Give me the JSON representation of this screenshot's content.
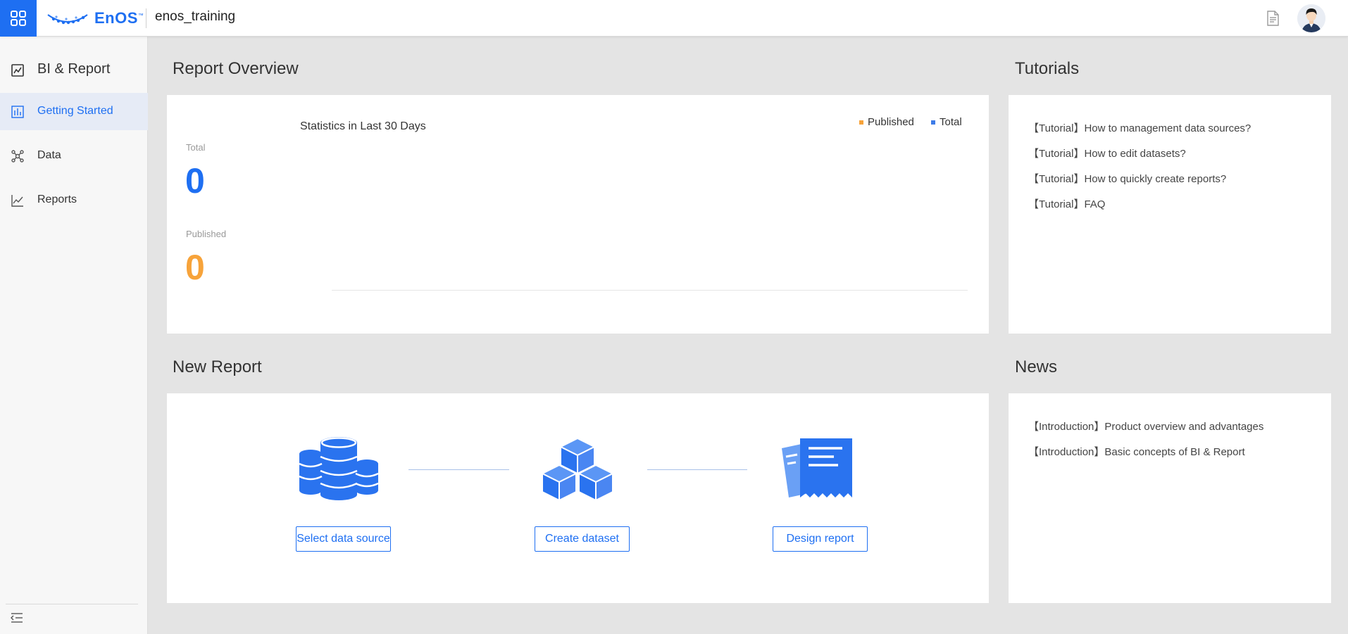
{
  "header": {
    "logo_text": "EnOS",
    "logo_tm": "™",
    "org_name": "enos_training",
    "icons": {
      "app_switcher": "grid-icon",
      "docs": "document-icon",
      "avatar": "user-avatar"
    }
  },
  "sidebar": {
    "title": "BI & Report",
    "items": [
      {
        "label": "Getting Started",
        "icon": "bar-chart-icon",
        "active": true
      },
      {
        "label": "Data",
        "icon": "molecule-icon",
        "active": false
      },
      {
        "label": "Reports",
        "icon": "line-chart-icon",
        "active": false
      }
    ],
    "collapse_icon": "collapse-menu-icon"
  },
  "overview": {
    "section_title": "Report Overview",
    "total_label": "Total",
    "total_value": "0",
    "published_label": "Published",
    "published_value": "0",
    "chart_title": "Statistics in Last 30 Days",
    "legend": [
      {
        "label": "Published",
        "color": "#f7a33a"
      },
      {
        "label": "Total",
        "color": "#3e7ce8"
      }
    ]
  },
  "chart_data": {
    "type": "line",
    "title": "Statistics in Last 30 Days",
    "series": [
      {
        "name": "Published",
        "values": []
      },
      {
        "name": "Total",
        "values": []
      }
    ],
    "legend_position": "top-right"
  },
  "tutorials": {
    "section_title": "Tutorials",
    "items": [
      "【Tutorial】How to management data sources?",
      "【Tutorial】How to edit datasets?",
      "【Tutorial】How to quickly create reports?",
      "【Tutorial】FAQ"
    ]
  },
  "new_report": {
    "section_title": "New Report",
    "steps": [
      {
        "button": "Select data source",
        "icon": "database-icon"
      },
      {
        "button": "Create dataset",
        "icon": "cubes-icon"
      },
      {
        "button": "Design report",
        "icon": "report-document-icon"
      }
    ]
  },
  "news": {
    "section_title": "News",
    "items": [
      "【Introduction】Product overview and advantages",
      "【Introduction】Basic concepts of BI & Report"
    ]
  },
  "colors": {
    "accent": "#1e6ff2",
    "total_value": "#1e6ff2",
    "published_value": "#f7a33a"
  }
}
